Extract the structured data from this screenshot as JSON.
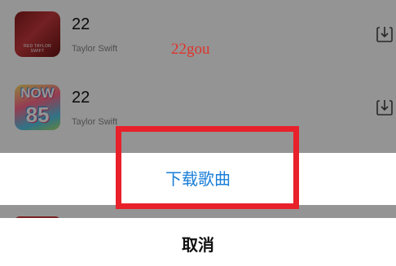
{
  "songs": [
    {
      "title": "22",
      "artist": "Taylor Swift",
      "art_text": "RED TAYLOR SWIFT"
    },
    {
      "title": "22",
      "artist": "Taylor Swift",
      "art_now": "NOW",
      "art_number": "85"
    }
  ],
  "watermark": "22gou",
  "action_sheet": {
    "option_label": "下载歌曲",
    "cancel_label": "取消"
  },
  "colors": {
    "option_text": "#1a7ed8",
    "highlight_border": "#e8202a",
    "watermark_text": "#e0332b"
  },
  "icons": {
    "download": "download-icon"
  }
}
